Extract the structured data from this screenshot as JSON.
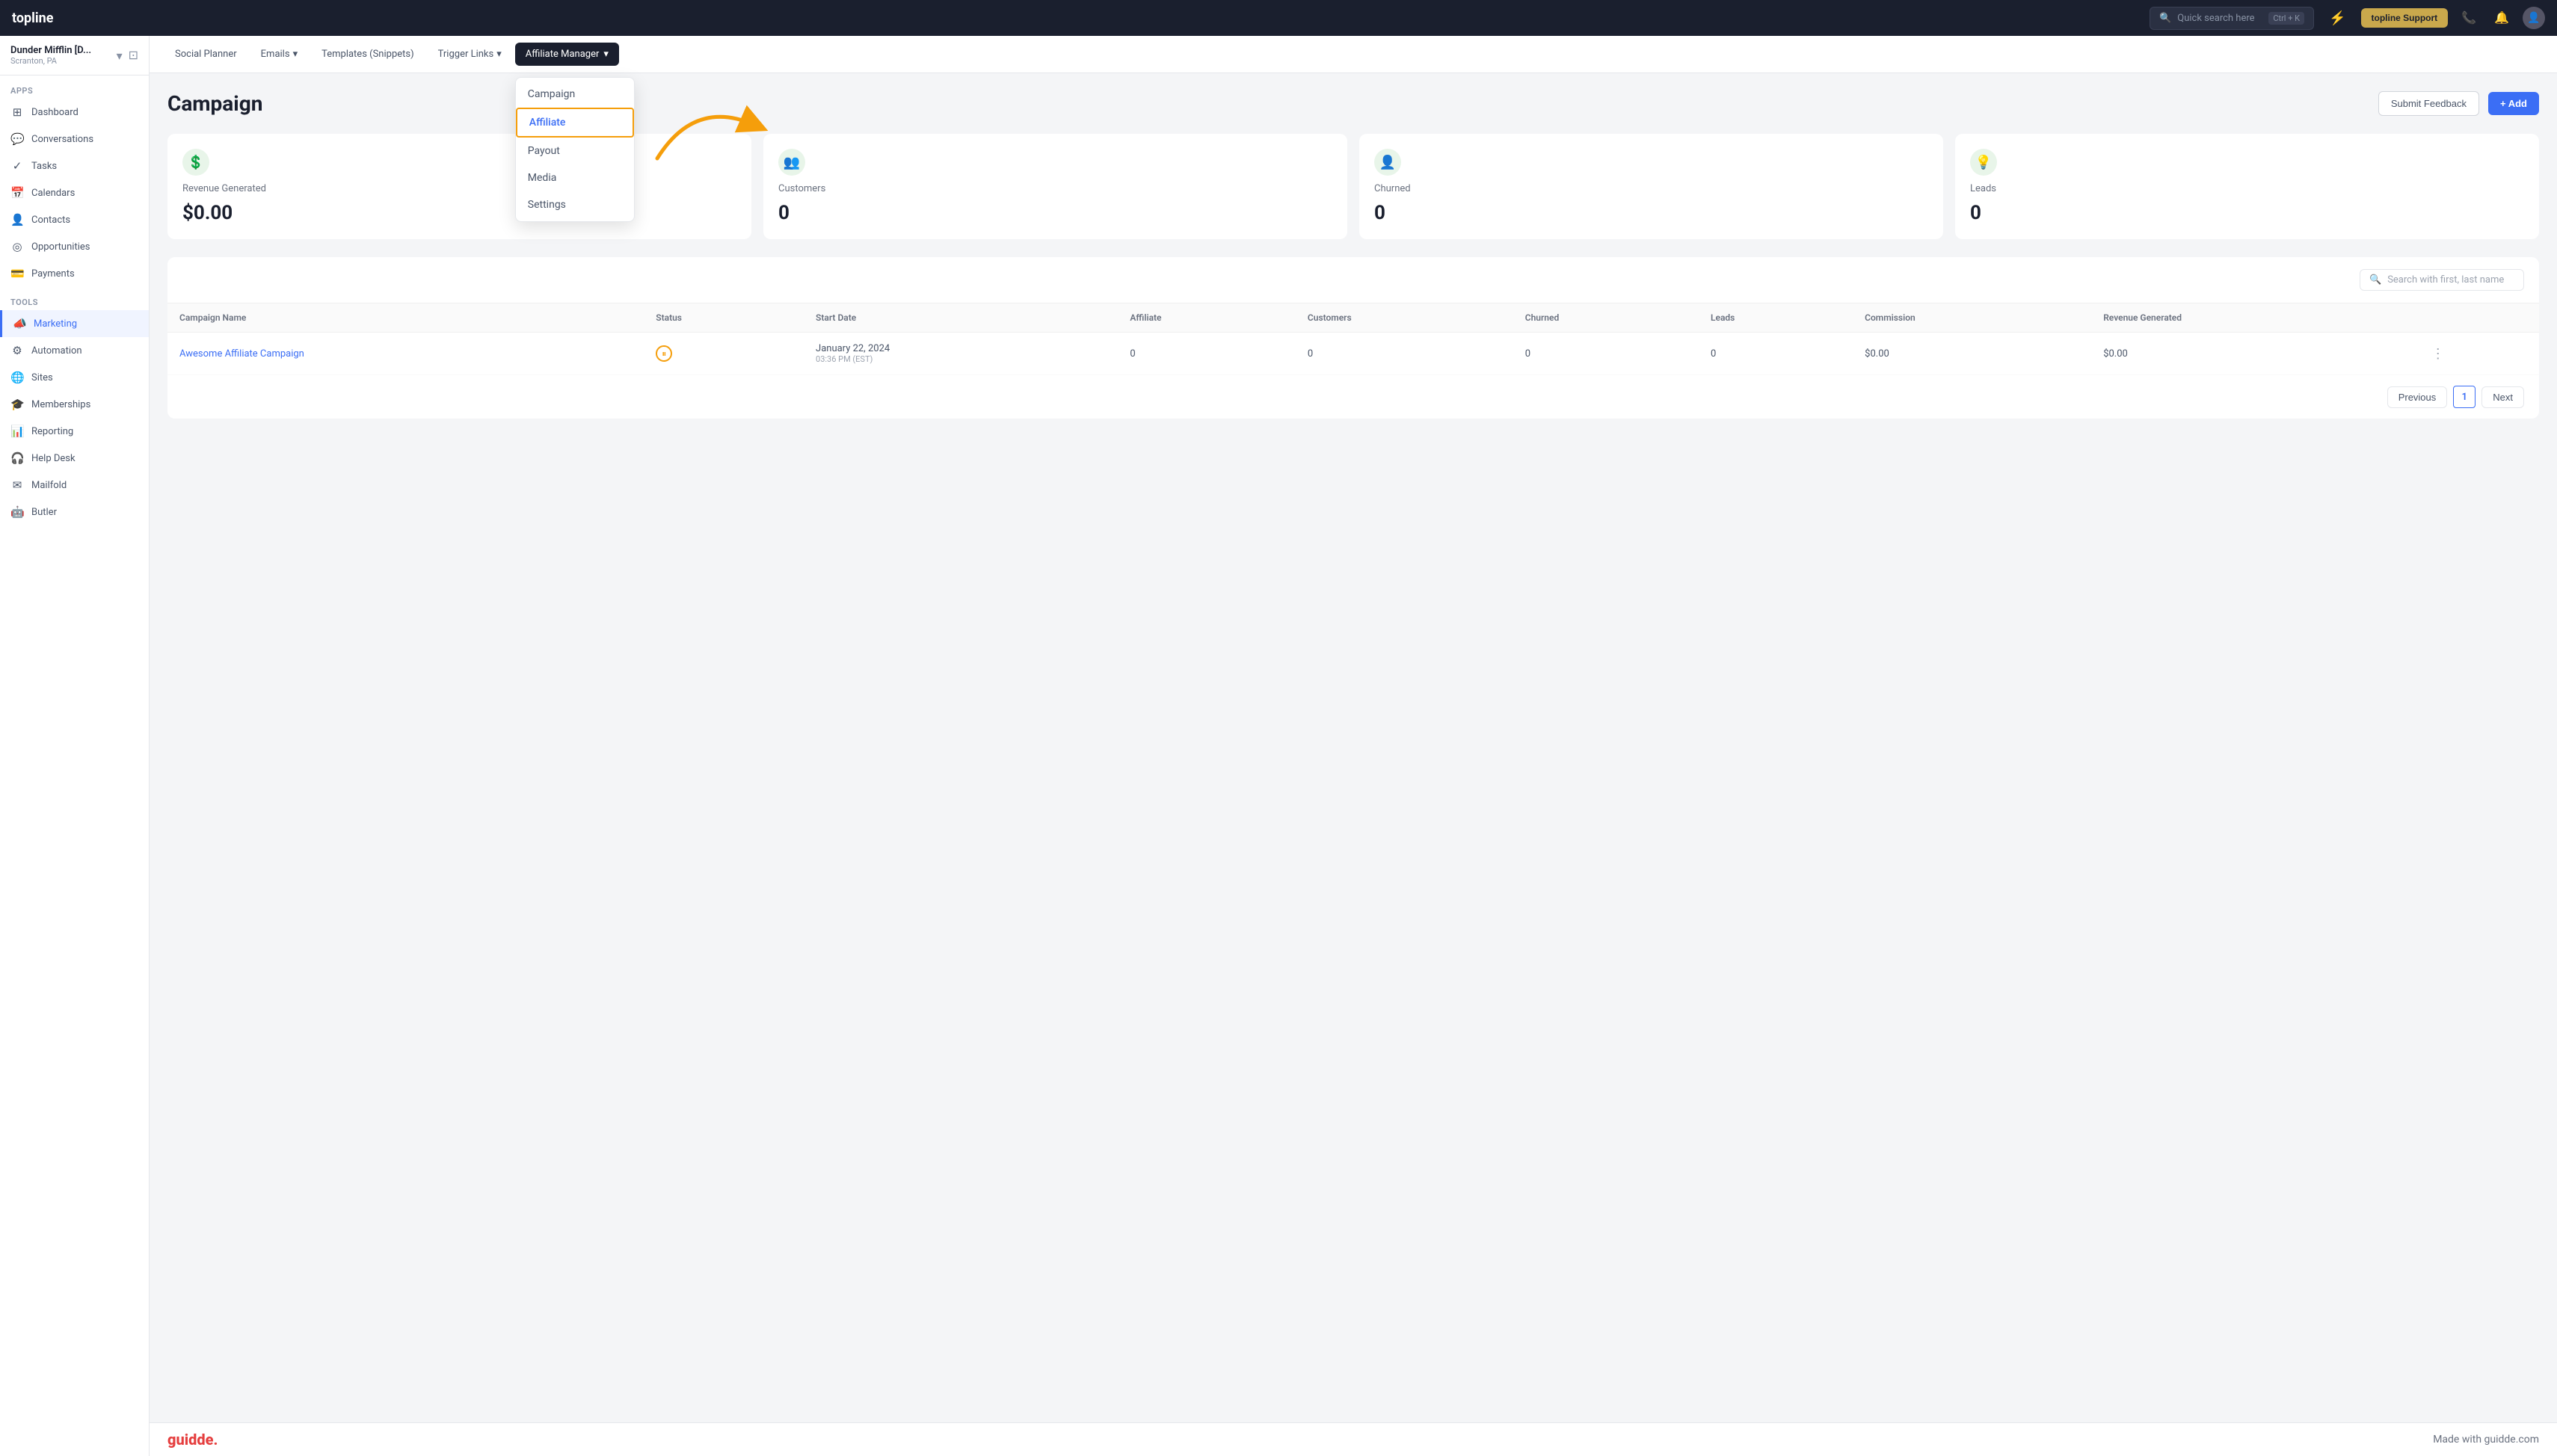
{
  "app": {
    "logo": "topline",
    "search_placeholder": "Quick search here",
    "search_shortcut": "Ctrl + K",
    "lightning_icon": "⚡",
    "support_btn": "topline Support"
  },
  "workspace": {
    "name": "Dunder Mifflin [D...",
    "location": "Scranton, PA"
  },
  "sidebar": {
    "apps_label": "Apps",
    "tools_label": "Tools",
    "apps_items": [
      {
        "icon": "⊞",
        "label": "Dashboard"
      },
      {
        "icon": "💬",
        "label": "Conversations"
      },
      {
        "icon": "✓",
        "label": "Tasks"
      },
      {
        "icon": "📅",
        "label": "Calendars"
      },
      {
        "icon": "👤",
        "label": "Contacts"
      },
      {
        "icon": "◎",
        "label": "Opportunities"
      },
      {
        "icon": "💳",
        "label": "Payments"
      }
    ],
    "tools_items": [
      {
        "icon": "📣",
        "label": "Marketing",
        "active": true
      },
      {
        "icon": "⚙",
        "label": "Automation"
      },
      {
        "icon": "🌐",
        "label": "Sites"
      },
      {
        "icon": "🎓",
        "label": "Memberships"
      },
      {
        "icon": "📊",
        "label": "Reporting"
      },
      {
        "icon": "🎧",
        "label": "Help Desk"
      },
      {
        "icon": "✉",
        "label": "Mailfold"
      },
      {
        "icon": "🤖",
        "label": "Butler"
      }
    ]
  },
  "sub_nav": {
    "items": [
      {
        "label": "Social Planner"
      },
      {
        "label": "Emails",
        "has_dropdown": true
      },
      {
        "label": "Templates (Snippets)"
      },
      {
        "label": "Trigger Links",
        "has_dropdown": true
      }
    ],
    "active_item": {
      "label": "Affiliate Manager",
      "has_dropdown": true
    },
    "dropdown_items": [
      {
        "label": "Campaign",
        "highlighted": false
      },
      {
        "label": "Affiliate",
        "highlighted": true
      },
      {
        "label": "Payout",
        "highlighted": false
      },
      {
        "label": "Media",
        "highlighted": false
      },
      {
        "label": "Settings",
        "highlighted": false
      }
    ]
  },
  "page": {
    "title": "Campaign",
    "feedback_btn": "Submit Feedback",
    "add_btn": "+ Add"
  },
  "stats": [
    {
      "icon": "💲",
      "label": "Revenue Generated",
      "value": "$0.00"
    },
    {
      "icon": "👥",
      "label": "Customers",
      "value": "0"
    },
    {
      "icon": "👤",
      "label": "Churned",
      "value": "0"
    },
    {
      "icon": "💡",
      "label": "Leads",
      "value": "0"
    }
  ],
  "table": {
    "search_placeholder": "Search with first, last name",
    "columns": [
      "Campaign Name",
      "Status",
      "Start Date",
      "Affiliate",
      "Customers",
      "Churned",
      "Leads",
      "Commission",
      "Revenue Generated"
    ],
    "rows": [
      {
        "name": "Awesome Affiliate Campaign",
        "status": "paused",
        "start_date": "January 22, 2024",
        "start_time": "03:36 PM (EST)",
        "affiliate": "0",
        "customers": "0",
        "churned": "0",
        "leads": "0",
        "commission": "$0.00",
        "revenue": "$0.00"
      }
    ]
  },
  "pagination": {
    "previous_label": "Previous",
    "next_label": "Next",
    "current_page": "1"
  },
  "bottom_bar": {
    "logo": "guidde.",
    "tagline": "Made with guidde.com"
  }
}
